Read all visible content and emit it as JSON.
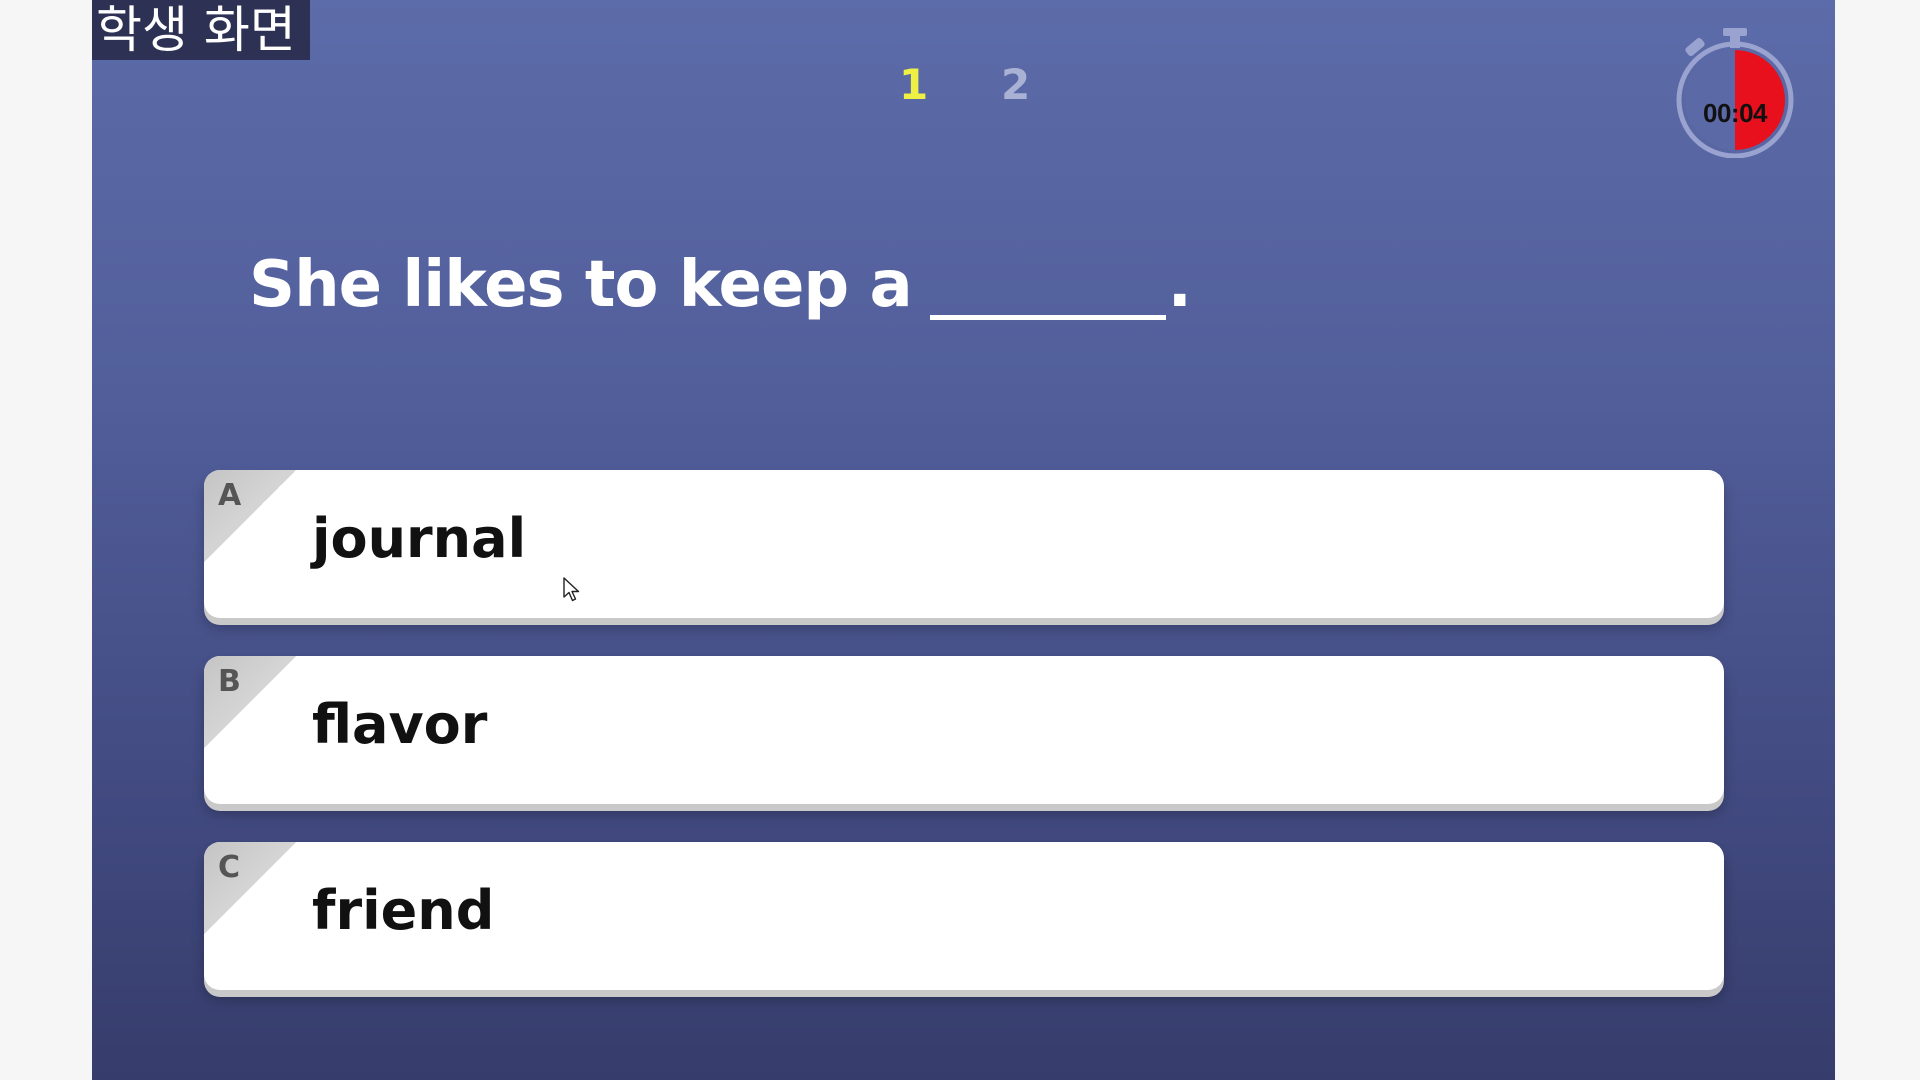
{
  "overlay": {
    "label": "학생 화면"
  },
  "pager": {
    "pages": [
      {
        "label": "1",
        "active": true
      },
      {
        "label": "2",
        "active": false
      }
    ]
  },
  "timer": {
    "display": "00:04",
    "remaining_fraction": 0.5
  },
  "question": {
    "text": "She likes to keep a",
    "end": "."
  },
  "options": [
    {
      "letter": "A",
      "text": "journal"
    },
    {
      "letter": "B",
      "text": "flavor"
    },
    {
      "letter": "C",
      "text": "friend"
    }
  ],
  "colors": {
    "background_top": "#5c6ba9",
    "background_bottom": "#363d6c",
    "active_page": "#eef043",
    "inactive_page": "#a9b1d4",
    "timer_fill": "#e8101c",
    "option_card": "#ffffff"
  },
  "icons": {
    "timer": "stopwatch-icon",
    "cursor": "mouse-pointer-icon"
  }
}
